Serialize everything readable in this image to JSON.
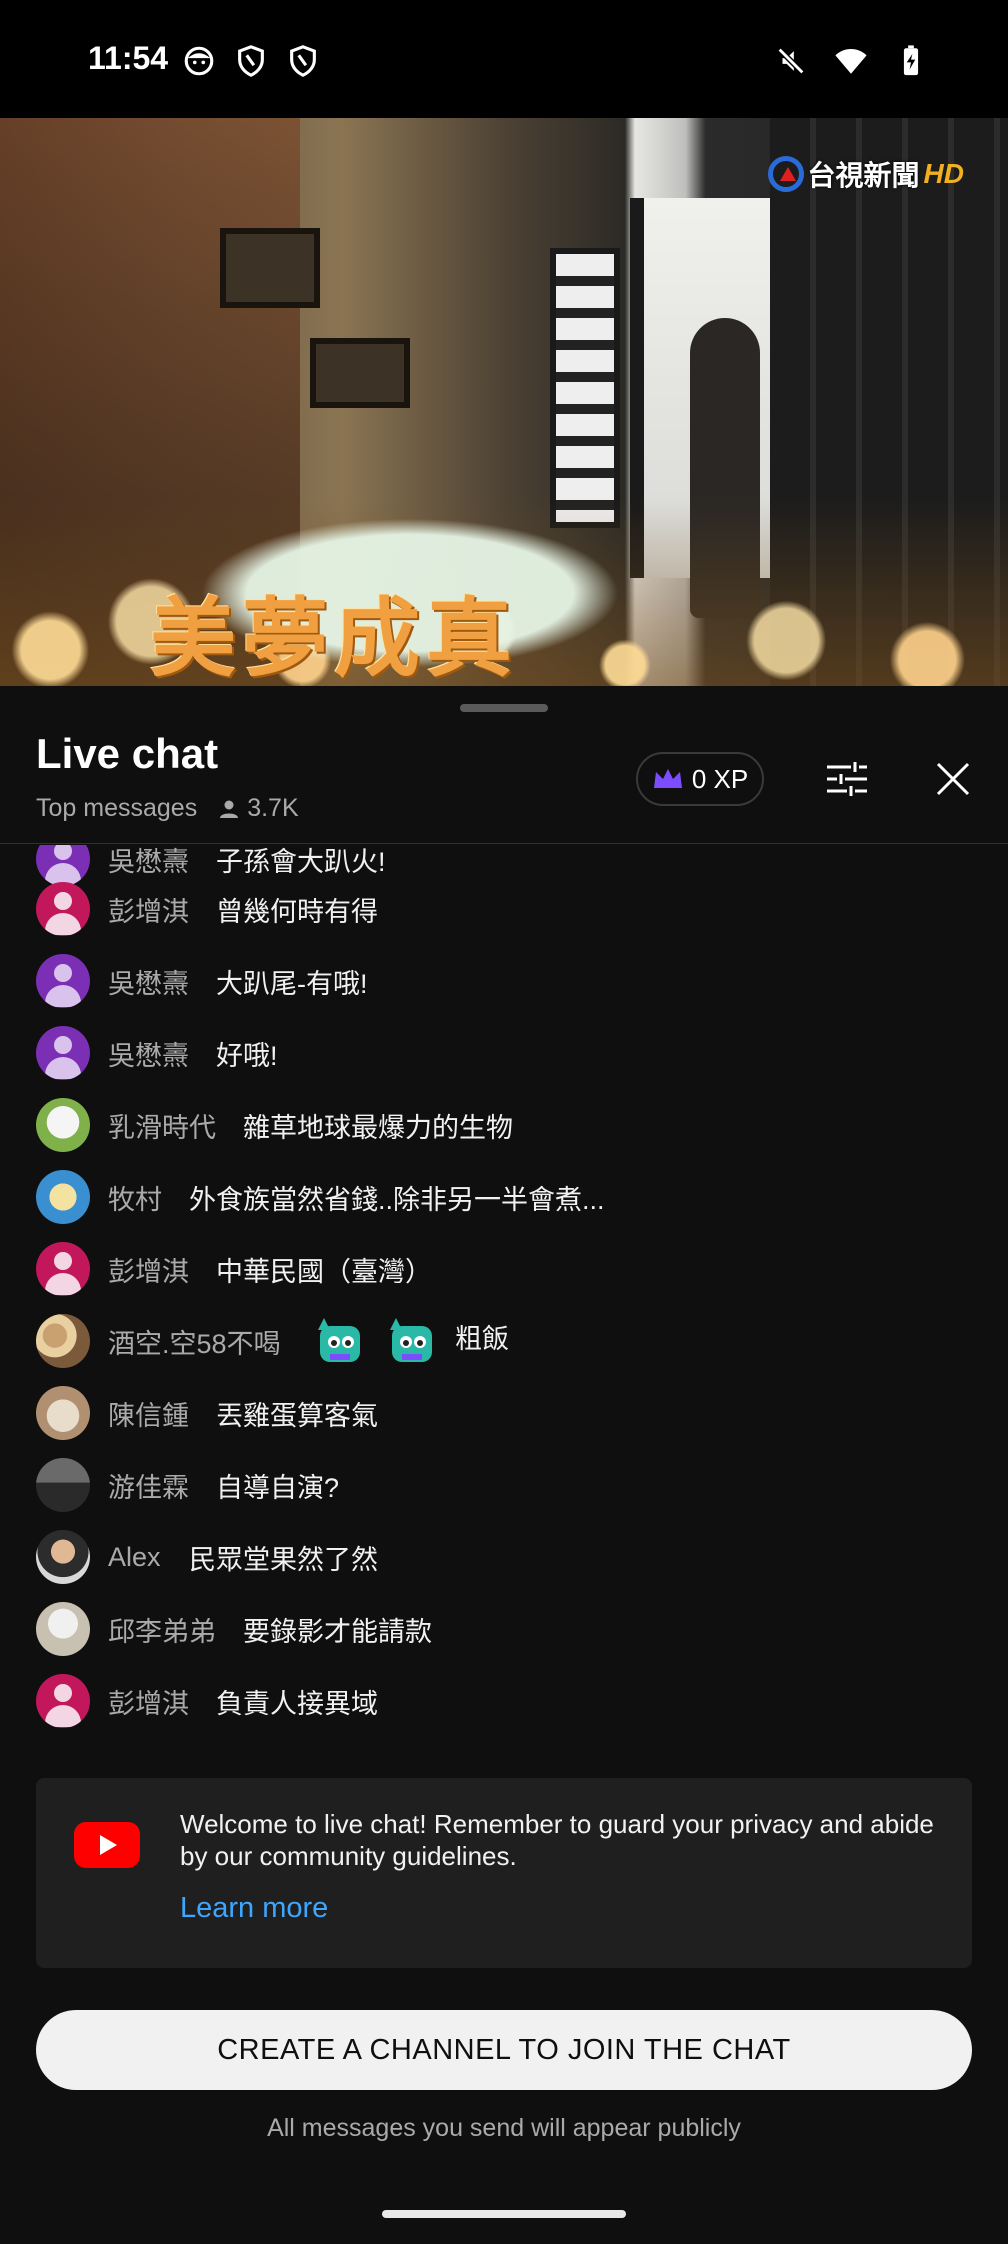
{
  "status_bar": {
    "time": "11:54",
    "left_icons": [
      "face-icon",
      "shield-icon",
      "shield-icon"
    ],
    "right_icons": [
      "mute-icon",
      "wifi-icon",
      "battery-charging-icon"
    ]
  },
  "video": {
    "caption": "美夢成真",
    "channel_name": "台視新聞",
    "channel_hd": "HD"
  },
  "chat": {
    "title": "Live chat",
    "mode": "Top messages",
    "viewers": "3.7K",
    "xp": "0 XP",
    "messages": [
      {
        "author": "吳懋燾",
        "text": "子孫會大趴火!",
        "avatar": "purple"
      },
      {
        "author": "彭增淇",
        "text": "曾幾何時有得",
        "avatar": "pink"
      },
      {
        "author": "吳懋燾",
        "text": "大趴尾-有哦!",
        "avatar": "purple"
      },
      {
        "author": "吳懋燾",
        "text": "好哦!",
        "avatar": "purple"
      },
      {
        "author": "乳滑時代",
        "text": "雜草地球最爆力的生物",
        "avatar": "photo1"
      },
      {
        "author": "牧村",
        "text": "外食族當然省錢..除非另一半會煮...",
        "avatar": "photo2"
      },
      {
        "author": "彭增淇",
        "text": "中華民國（臺灣）",
        "avatar": "pink"
      },
      {
        "author": "酒空.空58不喝",
        "text": "粗飯",
        "avatar": "photo3"
      },
      {
        "author": "陳信鍾",
        "text": "丟雞蛋算客氣",
        "avatar": "photo4"
      },
      {
        "author": "游佳霖",
        "text": "自導自演?",
        "avatar": "photo5"
      },
      {
        "author": "Alex",
        "text": "民眾堂果然了然",
        "avatar": "photo6"
      },
      {
        "author": "邱李弟弟",
        "text": "要錄影才能請款",
        "avatar": "photo7"
      },
      {
        "author": "彭增淇",
        "text": "負責人接異域",
        "avatar": "pink"
      }
    ]
  },
  "welcome": {
    "text": "Welcome to live chat! Remember to guard your privacy and abide by our community guidelines.",
    "link": "Learn more"
  },
  "create_button": "CREATE A CHANNEL TO JOIN THE CHAT",
  "public_note": "All messages you send will appear publicly",
  "colors": {
    "background": "#0f0f0f",
    "accent_link": "#3ea6ff",
    "youtube_red": "#ff0000",
    "xp_crown": "#7c4dff"
  }
}
